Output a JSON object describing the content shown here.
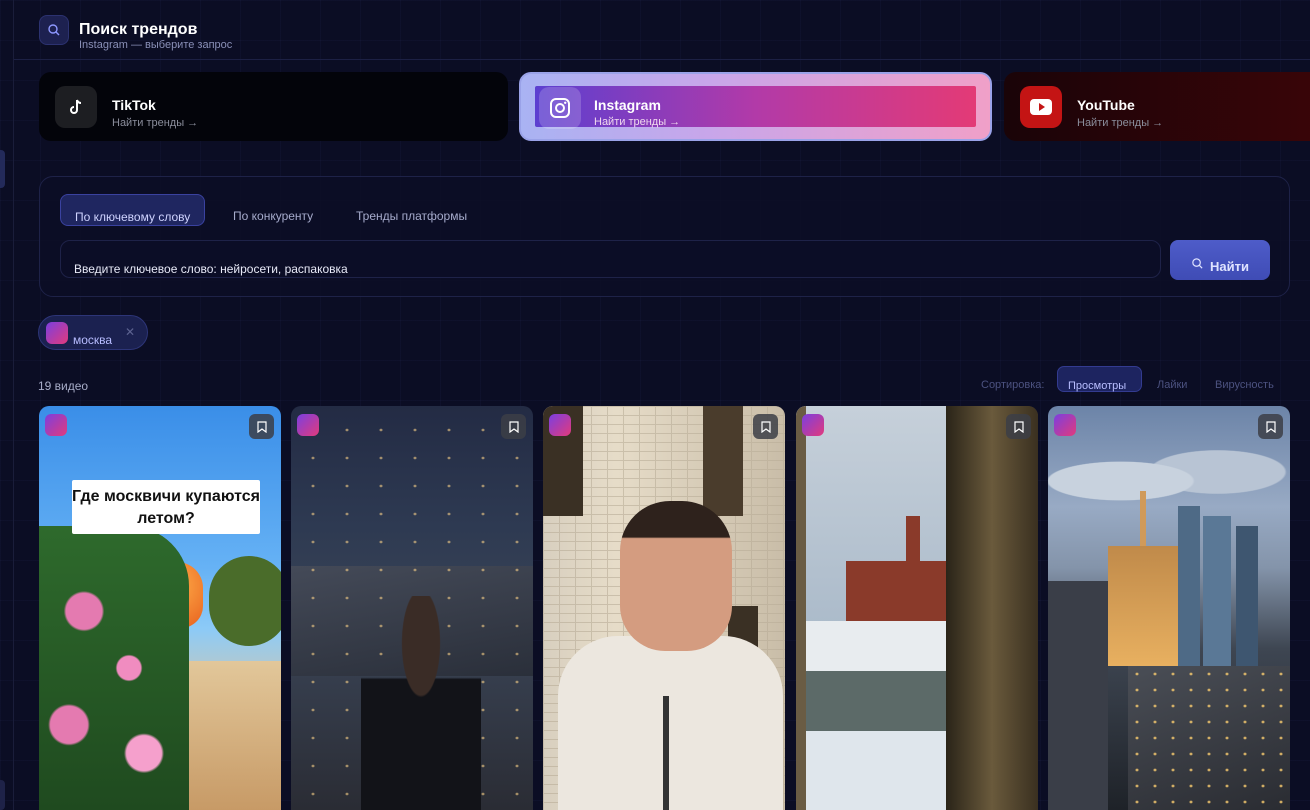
{
  "header": {
    "title": "Поиск трендов",
    "subtitle": "Instagram — выберите запрос"
  },
  "platforms": [
    {
      "name": "TikTok",
      "link": "Найти тренды →",
      "icon": "tiktok-icon"
    },
    {
      "name": "Instagram",
      "link": "Найти тренды →",
      "icon": "instagram-icon",
      "selected": true
    },
    {
      "name": "YouTube",
      "link": "Найти тренды →",
      "icon": "youtube-icon"
    }
  ],
  "search": {
    "tabs": [
      "По ключевому слову",
      "По конкуренту",
      "Тренды платформы"
    ],
    "active_tab": "По ключевому слову",
    "input_value": "Введите ключевое слово: нейросети, распаковка",
    "button_label": "Найти"
  },
  "filter_chip": {
    "label": "москва"
  },
  "results": {
    "count_label": "19 видео",
    "sort_label": "Сортировка:",
    "sort_options": [
      "Просмотры",
      "Лайки",
      "Вирусность"
    ],
    "active_sort": "Просмотры"
  },
  "cards": [
    {
      "caption": "Где москвичи купаются летом?",
      "badge": "instagram-badge-icon",
      "save": "bookmark-icon"
    },
    {
      "badge": "instagram-badge-icon",
      "save": "bookmark-icon"
    },
    {
      "badge": "instagram-badge-icon",
      "save": "bookmark-icon"
    },
    {
      "badge": "instagram-badge-icon",
      "save": "bookmark-icon"
    },
    {
      "badge": "instagram-badge-icon",
      "save": "bookmark-icon"
    }
  ],
  "colors": {
    "background": "#0b0d24",
    "accent": "#4e5cc9",
    "instagram_gradient_start": "#5c3fd0",
    "instagram_gradient_end": "#e33a76",
    "youtube_red": "#c41414"
  }
}
